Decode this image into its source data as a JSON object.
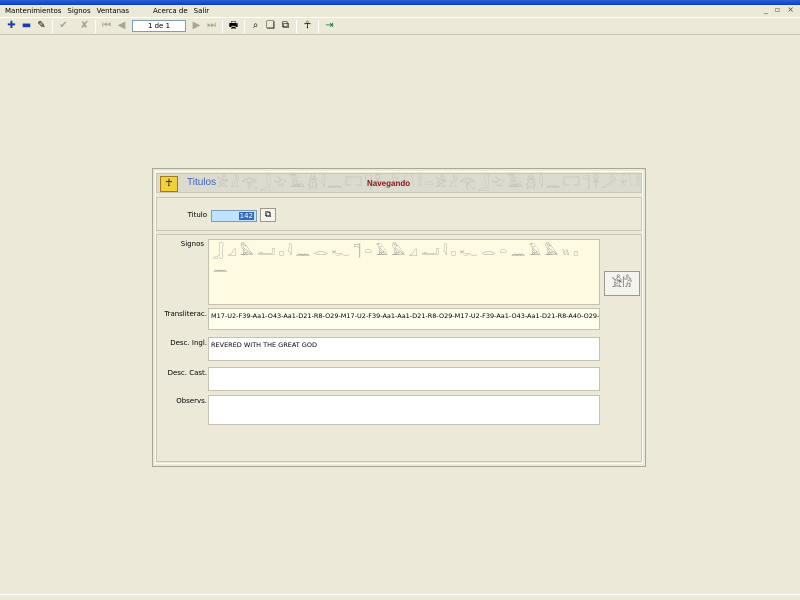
{
  "window": {
    "controls": [
      "_",
      "▫",
      "×"
    ]
  },
  "menu": {
    "items": [
      "Mantenimientos",
      "Signos",
      "Ventanas",
      "Acerca de",
      "Salir"
    ]
  },
  "toolbar": {
    "record_counter": "1 de 1"
  },
  "form": {
    "header": {
      "title": "Titulos",
      "status": "Navegando"
    },
    "search": {
      "titulo_label": "Titulo",
      "titulo_value": "142"
    },
    "fields": {
      "signos_label": "Signos",
      "signos_glyphs": "𓃀 𓈎 𓅓 𓂝 𓊪 𓇋 𓈖 𓂋 𓆑 𓊹 𓏏 𓄿 𓅓 𓈎 𓂝 𓇋 𓊪 𓆑 𓂋 𓏏 𓈖 𓄿 𓅓 𓏭 𓊪 𓈖",
      "transliterac_label": "Transliterac.",
      "transliterac_value": "M17-U2-F39-Aa1-O43-Aa1-D21-R8-O29-M17-U2-F39-Aa1-Aa1-D21-R8-O29-M17-U2-F39-Aa1-O43-Aa1-D21-R8-A40-O29-",
      "desc_ingl_label": "Desc. Ingl.",
      "desc_ingl_value": "REVERED WITH THE GREAT GOD",
      "desc_cast_label": "Desc. Cast.",
      "desc_cast_value": "",
      "observs_label": "Observs.",
      "observs_value": ""
    }
  }
}
